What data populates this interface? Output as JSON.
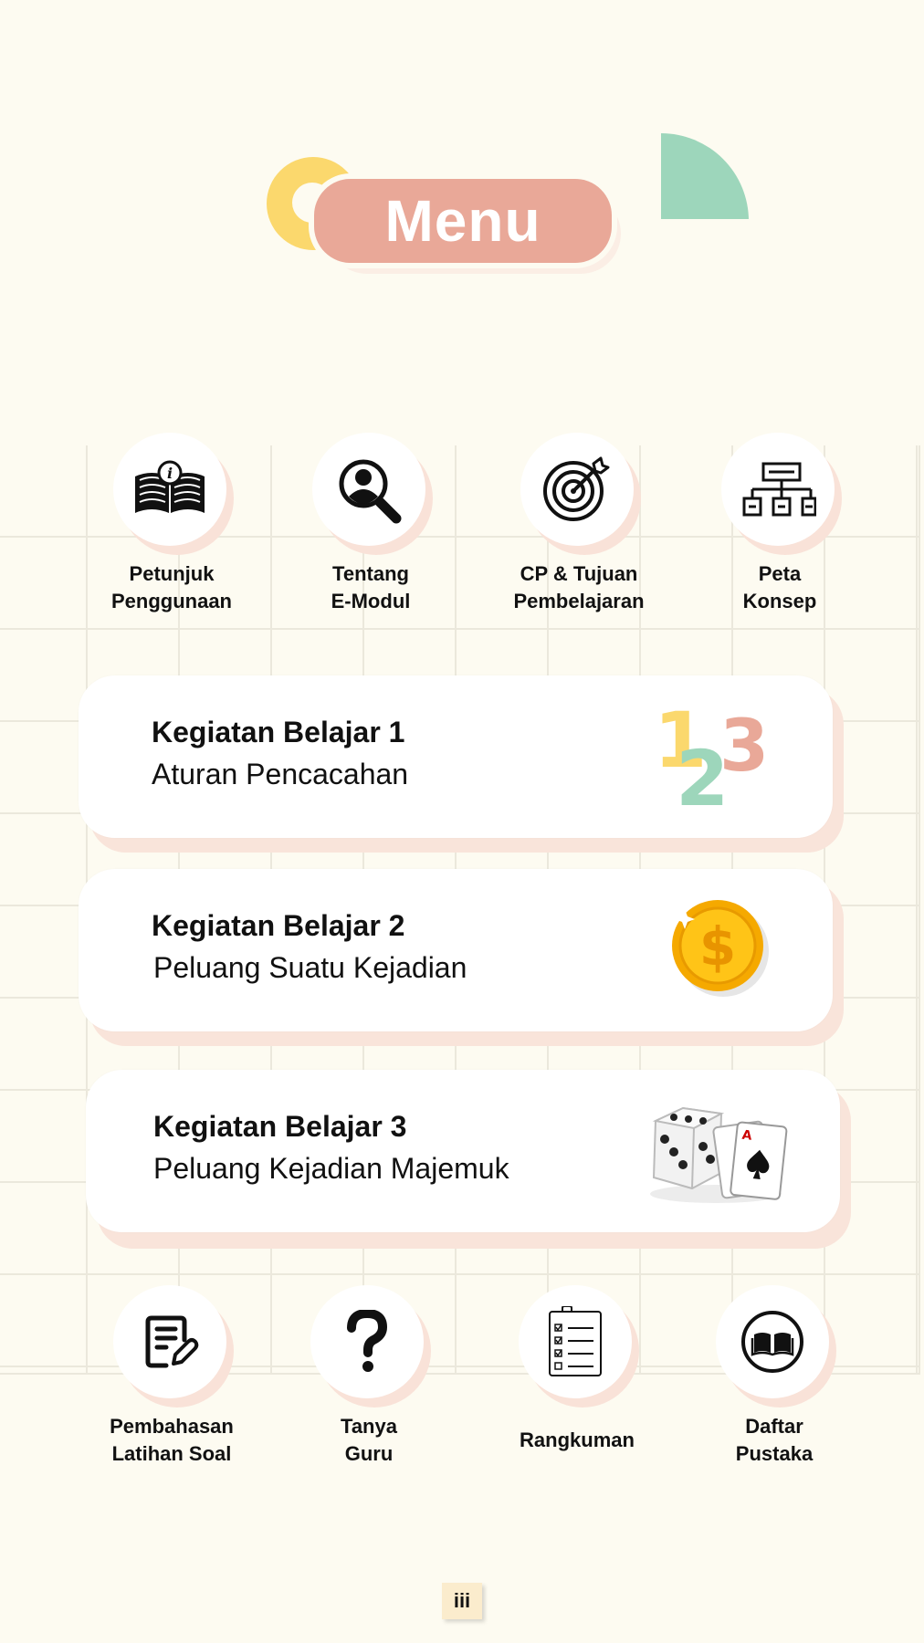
{
  "header": {
    "title": "Menu"
  },
  "top_menu": [
    {
      "line1": "Petunjuk",
      "line2": "Penggunaan",
      "icon": "book-info-icon"
    },
    {
      "line1": "Tentang",
      "line2": "E-Modul",
      "icon": "search-user-icon"
    },
    {
      "line1": "CP & Tujuan",
      "line2": "Pembelajaran",
      "icon": "target-icon"
    },
    {
      "line1": "Peta",
      "line2": "Konsep",
      "icon": "concept-map-icon"
    }
  ],
  "cards": [
    {
      "title": "Kegiatan Belajar 1",
      "subtitle": "Aturan Pencacahan",
      "icon": "numbers-123-icon",
      "digits": [
        "1",
        "2",
        "3"
      ],
      "colors": [
        "#fbd86d",
        "#9dd6bb",
        "#e9a898"
      ]
    },
    {
      "title": "Kegiatan Belajar 2",
      "subtitle": "Peluang Suatu Kejadian",
      "icon": "gold-coin-icon",
      "coin_symbol": "$"
    },
    {
      "title": "Kegiatan Belajar 3",
      "subtitle": "Peluang Kejadian Majemuk",
      "icon": "dice-and-cards-icon",
      "card_rank": "A"
    }
  ],
  "bottom_menu": [
    {
      "line1": "Pembahasan",
      "line2": "Latihan Soal",
      "icon": "edit-document-icon"
    },
    {
      "line1": "Tanya",
      "line2": "Guru",
      "icon": "question-mark-icon"
    },
    {
      "line1": "Rangkuman",
      "line2": "",
      "icon": "checklist-icon"
    },
    {
      "line1": "Daftar",
      "line2": "Pustaka",
      "icon": "open-book-icon"
    }
  ],
  "page_number": "iii",
  "colors": {
    "background": "#fdfbf1",
    "accent_pink": "#e9a898",
    "accent_yellow": "#fbd86d",
    "accent_green": "#9dd6bb",
    "shadow": "#f9e4da"
  }
}
